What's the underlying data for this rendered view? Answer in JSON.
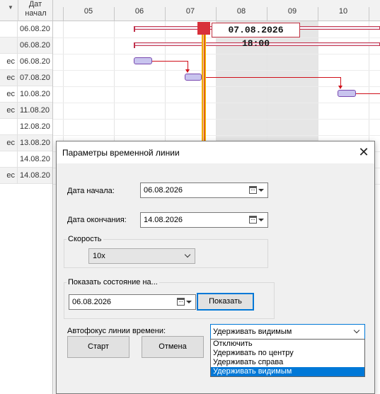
{
  "grid": {
    "header_line1": "Дат",
    "header_line2": "начал",
    "rows": [
      {
        "c1": "",
        "date": "06.08.20"
      },
      {
        "c1": "",
        "date": "06.08.20"
      },
      {
        "c1": "ес",
        "date": "06.08.20"
      },
      {
        "c1": "ес",
        "date": "07.08.20"
      },
      {
        "c1": "ес",
        "date": "10.08.20"
      },
      {
        "c1": "ес",
        "date": "11.08.20"
      },
      {
        "c1": "",
        "date": "12.08.20"
      },
      {
        "c1": "ес",
        "date": "13.08.20"
      },
      {
        "c1": "",
        "date": "14.08.20"
      },
      {
        "c1": "ес",
        "date": "14.08.20"
      }
    ]
  },
  "gantt": {
    "day_labels": [
      "05",
      "06",
      "07",
      "08",
      "09",
      "10"
    ],
    "timeline_label": "07.08.2026 18:00"
  },
  "dialog": {
    "title": "Параметры временной линии",
    "close_glyph": "✕",
    "start_date_label": "Дата начала:",
    "start_date_value": "06.08.2026",
    "end_date_label": "Дата окончания:",
    "end_date_value": "14.08.2026",
    "speed_group_title": "Скорость",
    "speed_value": "10x",
    "show_state_group_title": "Показать состояние на...",
    "show_state_date_value": "06.08.2026",
    "show_button": "Показать",
    "autofocus_label": "Автофокус линии времени:",
    "autofocus_value": "Удерживать видимым",
    "autofocus_options": [
      "Отключить",
      "Удерживать по центру",
      "Удерживать справа",
      "Удерживать видимым"
    ],
    "autofocus_selected_index": 3,
    "start_button": "Старт",
    "cancel_button": "Отмена"
  },
  "colors": {
    "accent": "#0078d7",
    "timeline_red": "#d8303a",
    "timeline_yellow": "#fbe7a4",
    "task_fill": "#c8c4ee",
    "link_red": "#d0101a",
    "weekend_gray": "#e6e6e6"
  }
}
